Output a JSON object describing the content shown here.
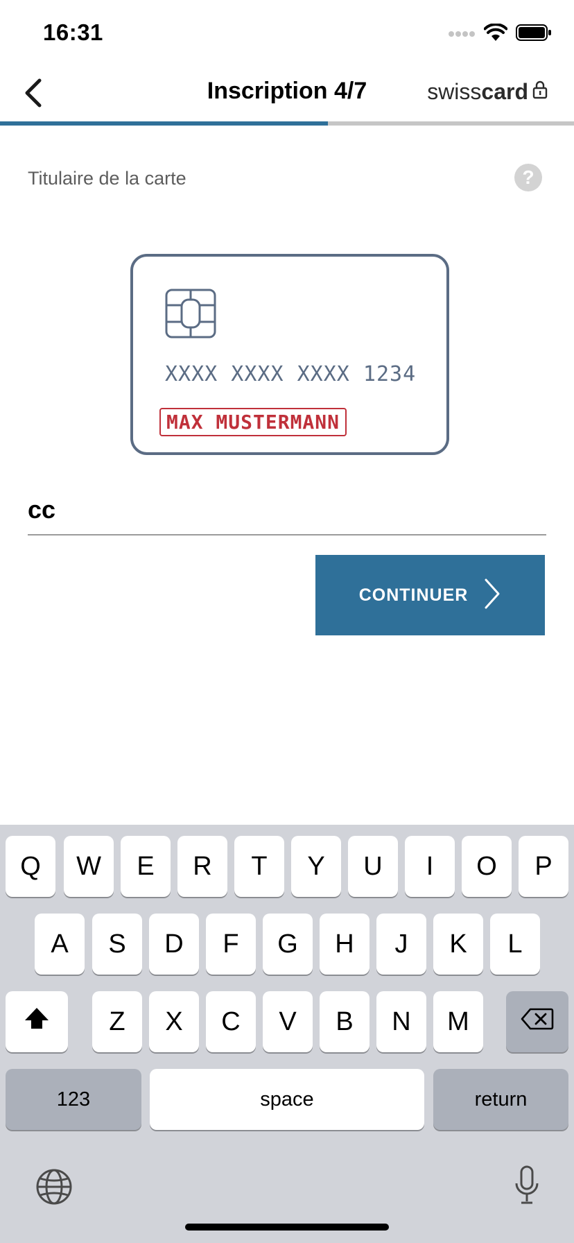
{
  "status_bar": {
    "time": "16:31",
    "icons": [
      "cellular-signal-icon",
      "wifi-icon",
      "battery-icon"
    ]
  },
  "nav": {
    "back_icon": "chevron-left-icon",
    "title": "Inscription 4/7",
    "brand": {
      "light": "swiss",
      "bold": "card",
      "icon": "lock-icon"
    }
  },
  "progress": {
    "step": 4,
    "total": 7,
    "fraction": 0.571,
    "fill_color": "#2f7099",
    "track_color": "#c6c6c6"
  },
  "section": {
    "label": "Titulaire de la carte",
    "help_icon_glyph": "?"
  },
  "card_illustration": {
    "number": "XXXX XXXX XXXX 1234",
    "holder_name": "MAX MUSTERMANN",
    "outline_color": "#5b6c84",
    "highlight_color": "#c0303a"
  },
  "form": {
    "cardholder_value": "cc"
  },
  "continue_button": {
    "label": "CONTINUER",
    "color": "#2f7099"
  },
  "keyboard": {
    "row1": [
      "Q",
      "W",
      "E",
      "R",
      "T",
      "Y",
      "U",
      "I",
      "O",
      "P"
    ],
    "row2": [
      "A",
      "S",
      "D",
      "F",
      "G",
      "H",
      "J",
      "K",
      "L"
    ],
    "row3": [
      "Z",
      "X",
      "C",
      "V",
      "B",
      "N",
      "M"
    ],
    "numbers_label": "123",
    "space_label": "space",
    "return_label": "return"
  }
}
